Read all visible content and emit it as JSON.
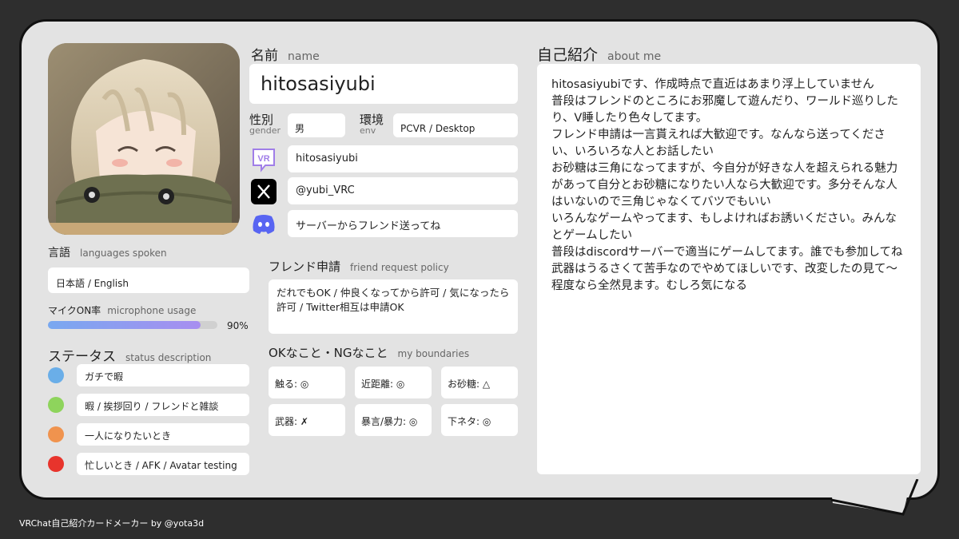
{
  "profile": {
    "name_label": "名前",
    "name_label_en": "name",
    "name": "hitosasiyubi",
    "gender_label": "性別",
    "gender_label_en": "gender",
    "gender": "男",
    "env_label": "環境",
    "env_label_en": "env",
    "env": "PCVR / Desktop"
  },
  "sns": [
    {
      "icon": "vrchat-icon",
      "value": "hitosasiyubi"
    },
    {
      "icon": "x-icon",
      "value": "@yubi_VRC"
    },
    {
      "icon": "discord-icon",
      "value": "サーバーからフレンド送ってね"
    }
  ],
  "languages": {
    "label": "言語",
    "label_en": "languages spoken",
    "value": "日本語 / English"
  },
  "mic": {
    "label": "マイクON率",
    "label_en": "microphone usage",
    "percent_text": "90%",
    "percent": 0.9
  },
  "status": {
    "label": "ステータス",
    "label_en": "status description",
    "items": [
      {
        "color": "#6aaee8",
        "text": "ガチで暇"
      },
      {
        "color": "#8ed45c",
        "text": "暇 / 挨拶回り / フレンドと雑談"
      },
      {
        "color": "#f0934e",
        "text": "一人になりたいとき"
      },
      {
        "color": "#e8342c",
        "text": "忙しいとき / AFK / Avatar testing"
      }
    ]
  },
  "friend_request": {
    "label": "フレンド申請",
    "label_en": "friend request policy",
    "text": "だれでもOK / 仲良くなってから許可 / 気になったら許可 / Twitter相互は申請OK"
  },
  "boundaries": {
    "label": "OKなこと・NGなこと",
    "label_en": "my boundaries",
    "items": [
      "触る: ◎",
      "近距離: ◎",
      "お砂糖: △",
      "武器: ✗",
      "暴言/暴力: ◎",
      "下ネタ: ◎"
    ]
  },
  "about": {
    "label": "自己紹介",
    "label_en": "about me",
    "paragraphs": [
      "hitosasiyubiです、作成時点で直近はあまり浮上していません",
      "普段はフレンドのところにお邪魔して遊んだり、ワールド巡りしたり、V睡したり色々してます。",
      "フレンド申請は一言貰えれば大歓迎です。なんなら送ってください、いろいろな人とお話したい",
      "お砂糖は三角になってますが、今自分が好きな人を超えられる魅力があって自分とお砂糖になりたい人なら大歓迎です。多分そんな人はいないので三角じゃなくてバツでもいい",
      "いろんなゲームやってます、もしよければお誘いください。みんなとゲームしたい",
      "普段はdiscordサーバーで適当にゲームしてます。誰でも参加してね",
      "武器はうるさくて苦手なのでやめてほしいです、改変したの見て〜程度なら全然見ます。むしろ気になる"
    ]
  },
  "footer": "VRChat自己紹介カードメーカー by @yota3d"
}
